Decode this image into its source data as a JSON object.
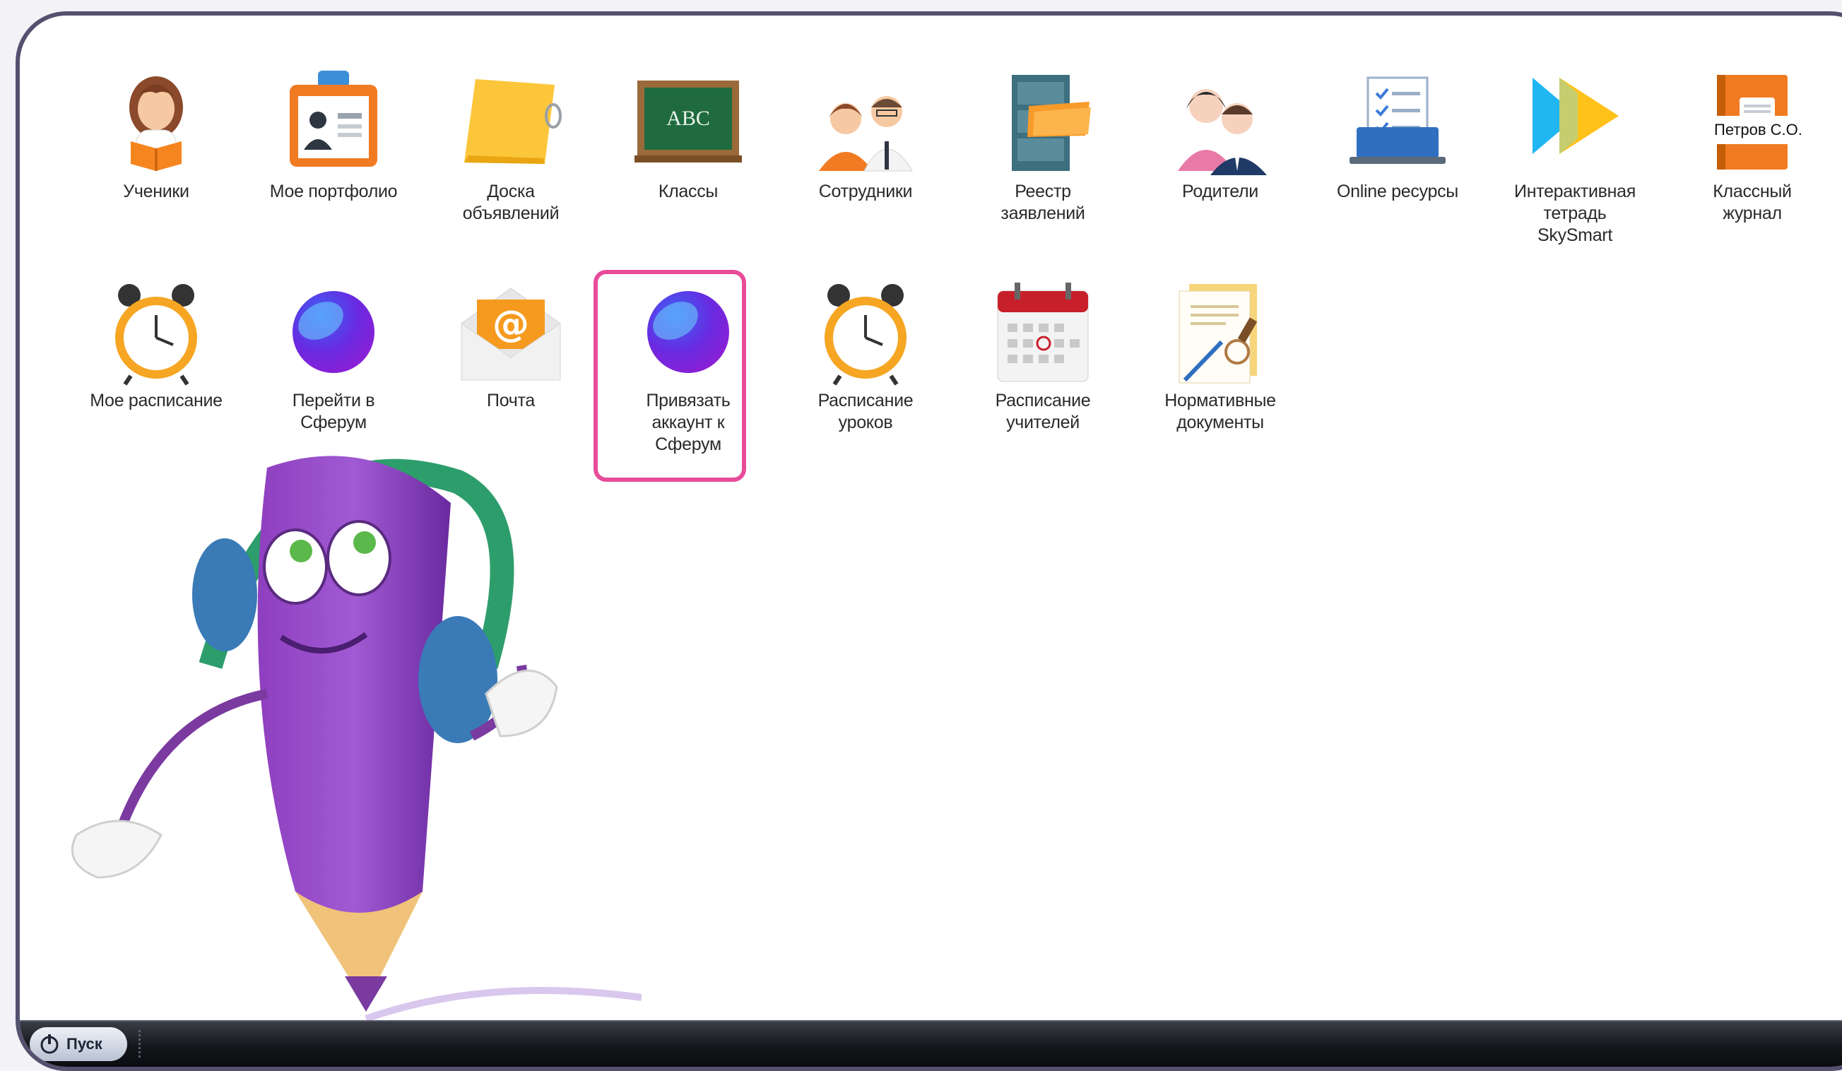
{
  "desktop": {
    "icons": [
      {
        "label": "Ученики",
        "icon": "student-icon"
      },
      {
        "label": "Мое портфолио",
        "icon": "portfolio-icon"
      },
      {
        "label": "Доска\nобъявлений",
        "icon": "sticky-note-icon"
      },
      {
        "label": "Классы",
        "icon": "chalkboard-icon"
      },
      {
        "label": "Сотрудники",
        "icon": "staff-icon"
      },
      {
        "label": "Реестр\nзаявлений",
        "icon": "file-cabinet-icon"
      },
      {
        "label": "Родители",
        "icon": "parents-icon"
      },
      {
        "label": "Online ресурсы",
        "icon": "laptop-checklist-icon"
      },
      {
        "label": "Интерактивная\nтетрадь\nSkySmart",
        "icon": "skysmart-play-icon"
      },
      {
        "label": "Классный\nжурнал",
        "icon": "journal-icon"
      },
      {
        "label": "Мое расписание",
        "icon": "alarm-clock-icon"
      },
      {
        "label": "Перейти в\nСферум",
        "icon": "sferum-icon"
      },
      {
        "label": "Почта",
        "icon": "mail-icon"
      },
      {
        "label": "Привязать\nаккаунт к\nСферум",
        "icon": "sferum-icon"
      },
      {
        "label": "Расписание\nуроков",
        "icon": "alarm-clock-icon"
      },
      {
        "label": "Расписание\nучителей",
        "icon": "calendar-icon"
      },
      {
        "label": "Нормативные\nдокументы",
        "icon": "documents-stamp-icon"
      }
    ],
    "highlighted_icon": "Привязать аккаунт к Сферум",
    "user_name": "Петров С.О."
  },
  "taskbar": {
    "start_label": "Пуск",
    "start_icon": "power-icon"
  },
  "colors": {
    "frame": "#54506e",
    "highlight": "#e74c9a",
    "sferum_blue": "#3a63f5",
    "sferum_purple": "#8b1fd6"
  }
}
